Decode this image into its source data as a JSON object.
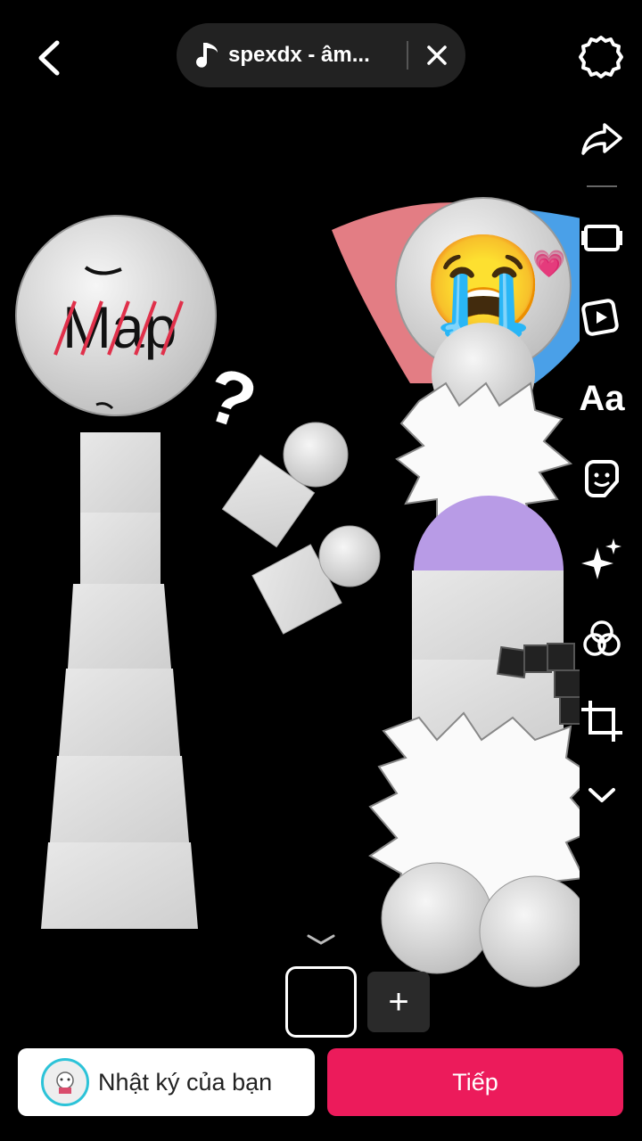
{
  "top_bar": {
    "sound_title": "spexdx - âm...",
    "icons": [
      "back-arrow-icon",
      "music-note-icon",
      "close-icon",
      "settings-gear-icon"
    ]
  },
  "toolbar": {
    "text_tool_label": "Aa",
    "items": [
      "share-arrow-icon",
      "template-icon",
      "video-edit-icon",
      "text-icon",
      "sticker-icon",
      "effects-sparkle-icon",
      "filters-icon",
      "crop-icon",
      "more-chevron-icon"
    ]
  },
  "canvas": {
    "left_figure_label": "Map",
    "question_mark": "?",
    "emoji": "😭",
    "emoji_small": "💗",
    "colors": {
      "head_fill": "#d9d9d9",
      "strike_red": "#e0304a",
      "fan_pink": "#e37d84",
      "fan_blue": "#4aa0e8",
      "torso_purple": "#b89be6"
    }
  },
  "bottom": {
    "add_clip_label": "+",
    "diary_label": "Nhật ký của bạn",
    "next_label": "Tiếp",
    "next_color": "#ec1b5b"
  }
}
